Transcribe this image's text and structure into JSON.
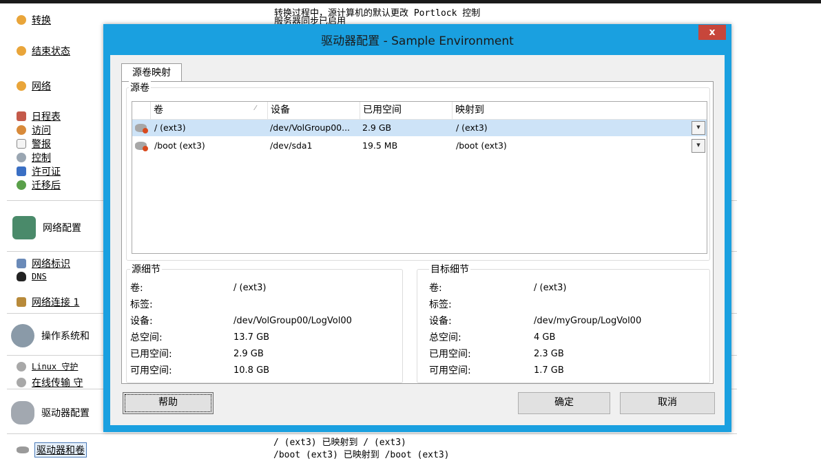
{
  "background": {
    "sidebar_items": [
      {
        "label": "转换",
        "icon": "coin-icon"
      },
      {
        "label": "结束状态",
        "icon": "coin-icon"
      },
      {
        "label": "网络",
        "icon": "coin-icon"
      },
      {
        "label": "日程表",
        "icon": "calendar-icon"
      },
      {
        "label": "访问",
        "icon": "user-icon"
      },
      {
        "label": "警报",
        "icon": "mail-icon"
      },
      {
        "label": "控制",
        "icon": "control-icon"
      },
      {
        "label": "许可证",
        "icon": "license-icon"
      },
      {
        "label": "迁移后",
        "icon": "post-migration-icon"
      }
    ],
    "group_network": "网络配置",
    "network_items": [
      "网络标识",
      "DNS",
      "网络连接 1"
    ],
    "group_os": "操作系统和",
    "os_items": [
      "Linux 守护",
      "在线传输 守"
    ],
    "group_drive": "驱动器配置",
    "drive_item": "驱动器和卷",
    "top_text_line1": "转换过程中，源计算机的默认更改 Portlock 控制",
    "top_text_line2": "服务器同步已启用",
    "bottom_text_line1": "/ (ext3) 已映射到 / (ext3)",
    "bottom_text_line2": "/boot (ext3) 已映射到 /boot (ext3)"
  },
  "dialog": {
    "title": "驱动器配置 - Sample Environment",
    "close_label": "x",
    "tab_label": "源卷映射",
    "source_volumes_label": "源卷",
    "columns": [
      "卷",
      "设备",
      "已用空间",
      "映射到"
    ],
    "rows": [
      {
        "volume": "/ (ext3)",
        "device": "/dev/VolGroup00...",
        "used": "2.9 GB",
        "mapped": "/ (ext3)"
      },
      {
        "volume": "/boot (ext3)",
        "device": "/dev/sda1",
        "used": "19.5 MB",
        "mapped": "/boot (ext3)"
      }
    ],
    "source_detail": {
      "label": "源细节",
      "fields": [
        {
          "name": "卷:",
          "value": "/ (ext3)"
        },
        {
          "name": "标签:",
          "value": ""
        },
        {
          "name": "设备:",
          "value": "/dev/VolGroup00/LogVol00"
        },
        {
          "name": "总空间:",
          "value": "13.7 GB"
        },
        {
          "name": "已用空间:",
          "value": "2.9 GB"
        },
        {
          "name": "可用空间:",
          "value": "10.8 GB"
        }
      ]
    },
    "target_detail": {
      "label": "目标细节",
      "fields": [
        {
          "name": "卷:",
          "value": "/ (ext3)"
        },
        {
          "name": "标签:",
          "value": ""
        },
        {
          "name": "设备:",
          "value": "/dev/myGroup/LogVol00"
        },
        {
          "name": "总空间:",
          "value": "4 GB"
        },
        {
          "name": "已用空间:",
          "value": "2.3 GB"
        },
        {
          "name": "可用空间:",
          "value": "1.7 GB"
        }
      ]
    },
    "help_button": "帮助",
    "ok_button": "确定",
    "cancel_button": "取消"
  },
  "colors": {
    "dialog_frame": "#1aa0e0",
    "close_button": "#c7463b",
    "selected_row": "#cde3f7"
  }
}
